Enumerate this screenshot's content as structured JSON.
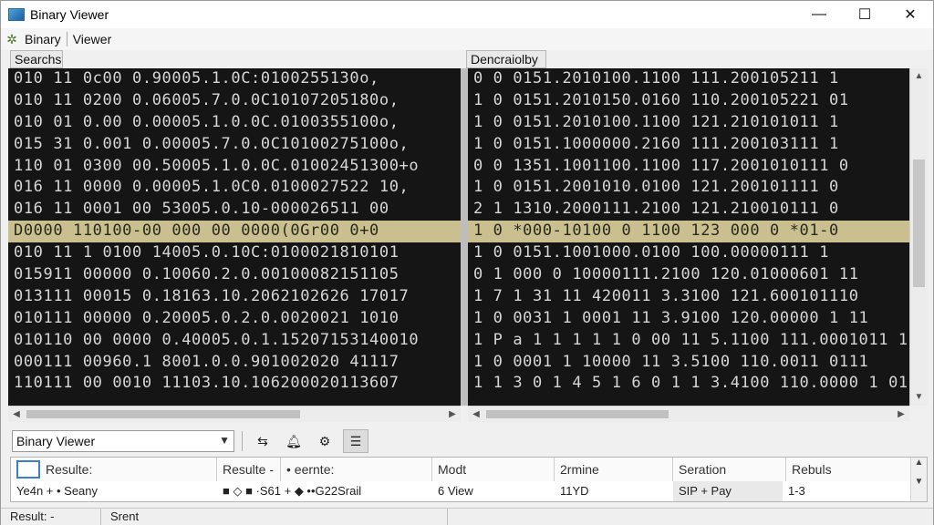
{
  "window": {
    "title": "Binary Viewer",
    "app_icon": "binary-viewer-app-icon",
    "controls": {
      "minimize": "—",
      "maximize": "☐",
      "close": "✕"
    }
  },
  "menubar": {
    "icon": "gear-plug-icon",
    "items": [
      "Binary",
      "Viewer"
    ]
  },
  "panes": {
    "left_header": "Searchs",
    "right_header": "Dencraiolby",
    "left_rows": [
      "010 11 0c00 0.90005.1.0C:0100255130o,",
      "010 11 0200 0.06005.7.0.0C10107205180o,",
      "010 01 0.00 0.00005.1.0.0C.0100355100o,",
      "015 31 0.001 0.00005.7.0.0C10100275100o,",
      "110 01 0300 00.50005.1.0.0C.01002451300+o",
      "016 11 0000 0.00005.1.0C0.0100027522 10,",
      "016 11 0001 00 53005.0.10-000026511 00",
      "D0000  110100-00 000 00 0000(0Gr00  0+0",
      "010 11 1 0100 14005.0.10C:0100021810101",
      "015911 00000 0.10060.2.0.00100082151105",
      "013111 00015 0.18163.10.2062102626 17017",
      "010111 00000 0.20005.0.2.0.0020021 1010",
      "010110 00 0000 0.40005.0.1.15207153140010",
      "000111 00960.1 8001.0.0.901002020 41117",
      "110111 00 0010 11103.10.106200020113607"
    ],
    "right_rows": [
      "0 0 0151.2010100.1100 111.200105211 1",
      "1 0 0151.2010150.0160 110.200105221 01",
      "1 0 0151.2010100.1100 121.210101011 1",
      "1 0 0151.1000000.2160 111.200103111 1",
      "0 0 1351.1001100.1100 117.2001010111 0",
      "1 0 0151.2001010.0100 121.200101111 0",
      "2 1 1310.2000111.2100 121.210010111 0",
      "1 0 *000-10100 0  1100 123  000 0 *01-0",
      "1 0 0151.1001000.0100 100.00000111 1",
      "0 1 000 0 10000111.2100 120.01000601 11",
      "1 7 1 31 11 420011 3.3100 121.600101110",
      "1 0 0031 1 0001 11 3.9100 120.00000 1 11",
      "1 P a 1 1 1 1 1 0 00 11 5.1100 111.0001011 1",
      "1 0 0001 1 10000 11 3.5100 110.0011 0111",
      "1 1 3 0 1 4 5 1 6 0 1 1 3.4100 110.0000 1 01 0"
    ],
    "highlight_row_index": 7
  },
  "toolbar": {
    "combo_value": "Binary Viewer",
    "buttons": [
      "swap-icon",
      "bell-icon",
      "filter-gear-icon",
      "filter-lines-icon"
    ]
  },
  "results_grid": {
    "columns": [
      "Resulte:",
      "Resulte -",
      "• eernte:",
      "Modt",
      "2rmine",
      "Seration",
      "Rebuls"
    ],
    "row": [
      "Ye4n + • Seany",
      "■ ◇ ■ ·S61 + ◆ ••G22Srail",
      "6 View",
      "11YD",
      "SIP + Pay",
      "1-3"
    ]
  },
  "statusbar": {
    "left": "Result: -",
    "right": "Srent"
  }
}
